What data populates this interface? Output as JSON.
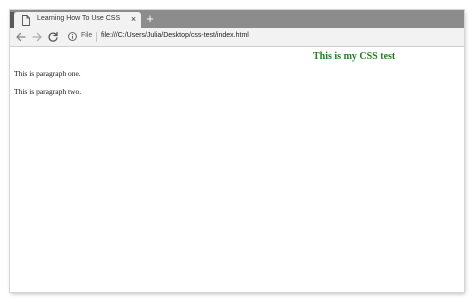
{
  "browser": {
    "tab": {
      "title": "Learning How To Use CSS",
      "close_glyph": "×",
      "icon": "page-icon"
    },
    "new_tab_glyph": "+",
    "toolbar": {
      "back_icon": "arrow-left-icon",
      "forward_icon": "arrow-right-icon",
      "reload_icon": "reload-icon",
      "info_icon": "info-icon",
      "file_label": "File",
      "address": "file:///C:/Users/Julia/Desktop/css-test/index.html"
    }
  },
  "page": {
    "heading": "This is my CSS test",
    "heading_color": "#1e7f1e",
    "paragraphs": [
      "This is paragraph one.",
      "This is paragraph two."
    ]
  }
}
